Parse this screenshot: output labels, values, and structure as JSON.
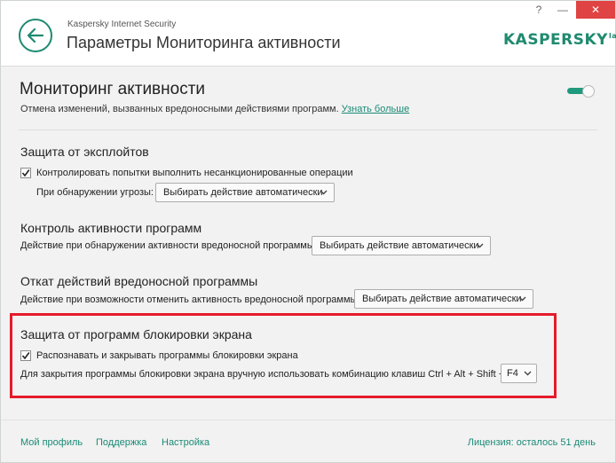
{
  "window": {
    "app_name": "Kaspersky Internet Security",
    "title": "Параметры Мониторинга активности",
    "help_label": "?",
    "minimize_label": "—",
    "close_label": "✕"
  },
  "logo": {
    "text": "KASPERSKY",
    "suffix": "lab"
  },
  "module": {
    "title": "Мониторинг активности",
    "description": "Отмена изменений, вызванных вредоносными действиями программ.",
    "learn_more": "Узнать больше",
    "enabled": true
  },
  "sections": {
    "exploits": {
      "title": "Защита от эксплойтов",
      "checkbox_label": "Контролировать попытки выполнить несанкционированные операции",
      "checked": true,
      "threat_label": "При обнаружении угрозы:",
      "threat_select": "Выбирать действие автоматически"
    },
    "control": {
      "title": "Контроль активности программ",
      "label": "Действие при обнаружении активности вредоносной программы:",
      "select": "Выбирать действие автоматически"
    },
    "rollback": {
      "title": "Откат действий вредоносной программы",
      "label": "Действие при возможности отменить активность вредоносной программы:",
      "select": "Выбирать действие автоматически"
    },
    "screen_lockers": {
      "title": "Защита от программ блокировки экрана",
      "checkbox_label": "Распознавать и закрывать программы блокировки экрана",
      "checked": true,
      "combo_label": "Для закрытия программы блокировки экрана вручную использовать комбинацию клавиш Ctrl + Alt + Shift +",
      "key_select": "F4"
    }
  },
  "footer": {
    "profile": "Мой профиль",
    "support": "Поддержка",
    "settings": "Настройка",
    "license": "Лицензия: осталось 51 день"
  },
  "colors": {
    "accent": "#1e8a72",
    "link": "#1a8a76",
    "highlight": "#e51b2a",
    "close": "#e04343"
  }
}
